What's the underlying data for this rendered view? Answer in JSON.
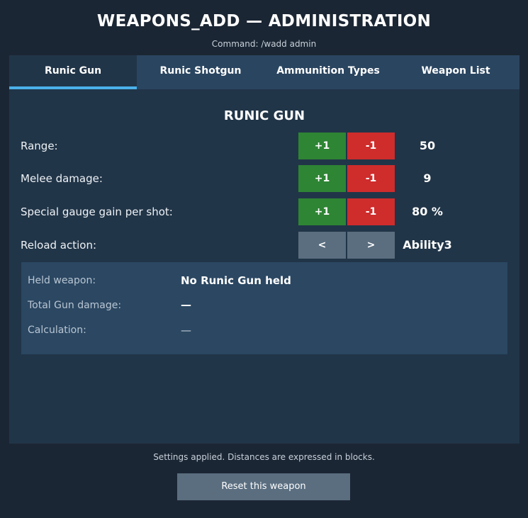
{
  "header": {
    "title": "WEAPONS_ADD — ADMINISTRATION",
    "subtitle": "Command: /wadd admin"
  },
  "tabs": [
    {
      "label": "Runic Gun",
      "active": true
    },
    {
      "label": "Runic Shotgun",
      "active": false
    },
    {
      "label": "Ammunition Types",
      "active": false
    },
    {
      "label": "Weapon List",
      "active": false
    }
  ],
  "panel": {
    "title": "RUNIC GUN",
    "rows": [
      {
        "label": "Range:",
        "inc": "+1",
        "dec": "-1",
        "value": "50"
      },
      {
        "label": "Melee damage:",
        "inc": "+1",
        "dec": "-1",
        "value": "9"
      },
      {
        "label": "Special gauge gain per shot:",
        "inc": "+1",
        "dec": "-1",
        "value": "80 %"
      },
      {
        "label": "Reload action:",
        "prev": "<",
        "next": ">",
        "value": "Ability3"
      }
    ],
    "info": {
      "held_label": "Held weapon:",
      "held_value": "No Runic Gun held",
      "damage_label": "Total Gun damage:",
      "damage_value": "—",
      "calc_label": "Calculation:",
      "calc_value": "—"
    }
  },
  "footer": {
    "status": "Settings applied. Distances are expressed in blocks.",
    "reset_label": "Reset this weapon"
  },
  "colors": {
    "background": "#1b2634",
    "panel": "#213548",
    "tab_bar": "#2a4560",
    "tab_active_indicator": "#4ab1ea",
    "increment": "#2e8534",
    "decrement": "#cf2c2c",
    "neutral_button": "#5a6e80",
    "info_box": "#2b4762"
  }
}
